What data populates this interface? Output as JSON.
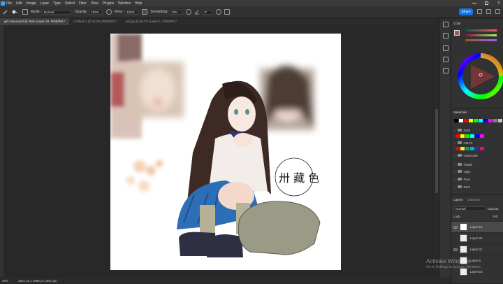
{
  "menu": [
    "File",
    "Edit",
    "Image",
    "Layer",
    "Type",
    "Select",
    "Filter",
    "View",
    "Plugins",
    "Window",
    "Help"
  ],
  "options": {
    "mode_label": "Mode:",
    "mode_value": "Normal",
    "opacity_label": "Opacity:",
    "opacity_value": "100%",
    "flow_label": "Flow:",
    "flow_value": "100%",
    "smoothing_label": "Smoothing:",
    "smoothing_value": "10%",
    "angle_value": "0°",
    "share_label": "Share"
  },
  "tabs": [
    {
      "label": "girl colour.psd @ 25% (Layer 19, RGB/8#) *",
      "active": true
    },
    {
      "label": "Untitled-1 @ 33.3% (RGB/8#) *",
      "active": false
    },
    {
      "label": "Lilt.jpg @ 66.7% (Layer 1, RGB/8#) *",
      "active": false
    }
  ],
  "status": {
    "zoom": "25%",
    "doc_size": "3561 px x 3888 px (300 ppi)"
  },
  "canvas": {
    "handwriting": "卅 藏 色"
  },
  "color_panel": {
    "tab": "Color",
    "fg": "#9b5c58",
    "bg": "#ffffff"
  },
  "swatches_panel": {
    "tab": "Swatches",
    "top_row": [
      "#000000",
      "#ffffff",
      "#ff0000",
      "#ffff00",
      "#00ff00",
      "#00ffff",
      "#0000ff",
      "#ff00ff",
      "#808080",
      "#c0c0c0"
    ],
    "groups": [
      {
        "name": "RGB",
        "colors": [
          "#ff0000",
          "#ffff00",
          "#00ff00",
          "#00ffff",
          "#0000ff",
          "#ff00ff"
        ]
      },
      {
        "name": "CMYK",
        "colors": [
          "#e0002a",
          "#fff200",
          "#00a651",
          "#00aeef",
          "#2e3192",
          "#ec008c"
        ]
      },
      {
        "name": "Grayscale"
      },
      {
        "name": "Pastel"
      },
      {
        "name": "Light"
      },
      {
        "name": "Pure"
      },
      {
        "name": "Dark"
      }
    ]
  },
  "layers_panel": {
    "tabs": [
      "Layers",
      "Channels"
    ],
    "blend_mode": "Normal",
    "opacity_label": "Opacity:",
    "opacity_value": "10",
    "lock_label": "Lock:",
    "fill_label": "Fill:",
    "layers": [
      {
        "name": "Layer 19",
        "selected": true
      },
      {
        "name": "Layer 24",
        "selected": false
      },
      {
        "name": "Layer 21",
        "selected": false
      },
      {
        "name": "Layer 5",
        "selected": false
      },
      {
        "name": "Layer 18",
        "selected": false
      }
    ]
  },
  "watermark": {
    "title": "Activate Windows",
    "subtitle": "Go to Settings to activate Windows."
  }
}
